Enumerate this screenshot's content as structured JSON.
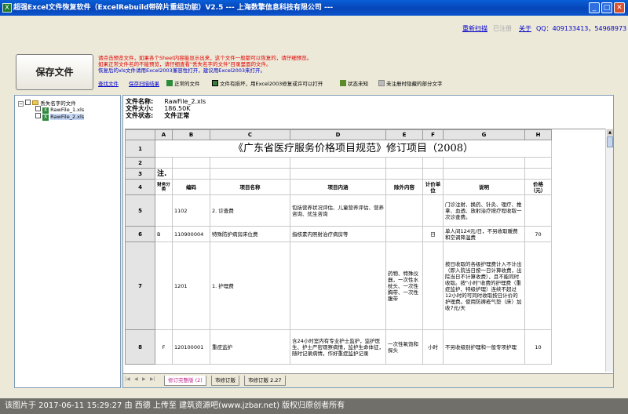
{
  "window": {
    "title": "超强Excel文件恢复软件（ExcelRebuild带碎片重组功能）V2.5 --- 上海数擎信息科技有限公司 ---",
    "minimize": "_",
    "maximize": "□",
    "close": "✕"
  },
  "toolbar": {
    "rescan": "重新扫描",
    "registered": "已注册",
    "about": "关于",
    "qq": "QQ：409133413，54968973"
  },
  "save_button": "保存文件",
  "hints": [
    "请点击预览文件，如果各个Sheet内容能显示出来，这个文件一般都可以恢复的，请仔细预览。",
    "如果正常文件名的不能预览，请仔细查看\"丢失名字的文件\"目录里面的文件。",
    "恢复后的xls文件请用Excel2003兼容性打开，建议用Excel2003来打开。"
  ],
  "legend": {
    "find": "查找文件",
    "save_result": "保存扫描结果",
    "normal": "正常的文件",
    "damaged": "文件有损坏，用Excel2003修复或许可以打开",
    "unknown": "状态未知",
    "unregistered": "未注册时隐藏的部分文字"
  },
  "tree": {
    "root": "丢失名字的文件",
    "files": [
      "RawFile_1.xls",
      "RawFile_2.xls"
    ]
  },
  "fileinfo": {
    "name_label": "文件名称:",
    "name": "RawFile_2.xls",
    "size_label": "文件大小:",
    "size": "186.50K",
    "status_label": "文件状态:",
    "status": "文件正常"
  },
  "sheet": {
    "columns": [
      "",
      "A",
      "B",
      "C",
      "D",
      "E",
      "F",
      "G",
      "H"
    ],
    "rows": [
      {
        "n": "1",
        "title": "《广东省医疗服务价格项目规范》修订项目（2008）"
      },
      {
        "n": "2",
        "cells": [
          "",
          "",
          "",
          "",
          "",
          "",
          "",
          ""
        ]
      },
      {
        "n": "3",
        "cells": [
          "注.",
          "",
          "",
          "",
          "",
          "",
          "",
          ""
        ]
      },
      {
        "n": "4",
        "cells": [
          "财务分类",
          "编码",
          "项目名称",
          "项目内涵",
          "除外内容",
          "计价单位",
          "说明",
          "价格（元）"
        ]
      },
      {
        "n": "5",
        "cells": [
          "",
          "1102",
          "2. 诊查费",
          "包括营养状况评估、儿童营养评估、营养咨询、优生咨询",
          "",
          "",
          "门诊注射、换药、针灸、理疗、推拿、血透、放射治疗按疗程收取一次诊查费。",
          ""
        ]
      },
      {
        "n": "6",
        "cells": [
          "B",
          "110900004",
          "特殊防护病房床位费",
          "指核素内照射治疗病房等",
          "",
          "日",
          "单人间124元/日，不另收取暖费和空调降温费",
          "70"
        ]
      },
      {
        "n": "7",
        "cells": [
          "",
          "1201",
          "1. 护理费",
          "",
          "药物、特殊仪器，一次性水枕头、一次性胸带、一次性腹带",
          "",
          "按日收取的各级护理费计入不计出（即入院当日按一日计算收费，出院当日不计算收费），且不能同时收取。按\"小时\"收费的护理费（重症监护、特级护理）连续不超过12小时的可同时收取按日计价的护理费。使用防褥疮气垫（床）加收7元/天",
          ""
        ]
      },
      {
        "n": "8",
        "cells": [
          "F",
          "120100001",
          "重症监护",
          "含24小时室内有专业护士监护，监护医生、护士严密观察病情，监护生命体征，随时记录病情，作好重症监护记录",
          "一次性氧饱和探头",
          "小时",
          "不另收级别护理和一般专项护理",
          "10"
        ]
      }
    ]
  },
  "tabs": {
    "nav": [
      "|◀",
      "◀",
      "▶",
      "▶|"
    ],
    "items": [
      "修订完整版 (2)",
      "市修订版",
      "市修订版 2.27"
    ]
  },
  "status": "该图片于 2017-06-11 15:29:27 由 西德 上传至 建筑资源吧(www.jzbar.net) 版权归原创者所有",
  "colors": {
    "title_bar": "#0a5fd8",
    "hint_red": "#e00000",
    "hint_blue": "#0000c8",
    "link": "#0000c8"
  }
}
